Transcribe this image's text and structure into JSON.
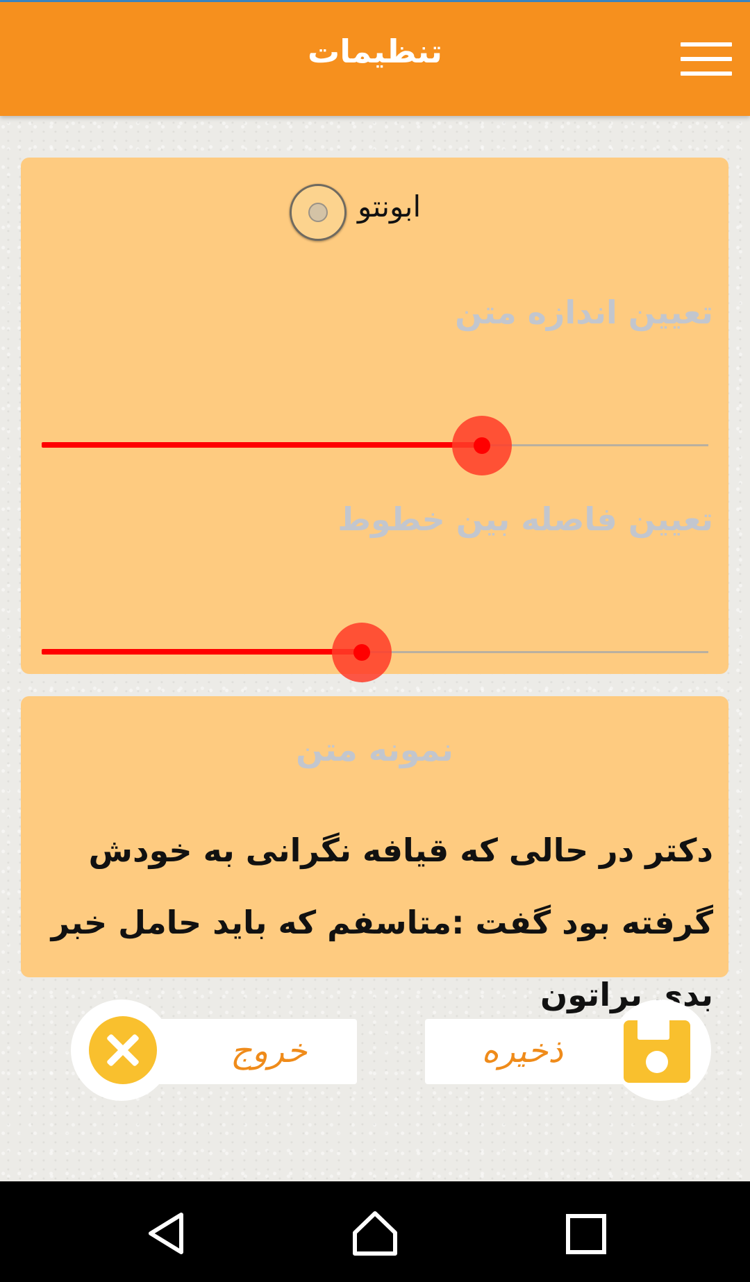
{
  "app_bar": {
    "title": "تنظیمات",
    "menu_icon": "hamburger-menu-icon",
    "background_color": "#f6901e"
  },
  "font_option": {
    "label": "ابونتو",
    "selected": false
  },
  "text_size": {
    "label": "تعیین اندازه متن",
    "value_fraction": 0.66
  },
  "line_spacing": {
    "label": "تعیین فاصله بین خطوط",
    "value_fraction": 0.48
  },
  "preview": {
    "title": "نمونه متن",
    "text": "دکتر در حالی که قیافه نگرانی به خودش گرفته بود گفت :متاسفم که باید حامل خبر بدی براتون"
  },
  "actions": {
    "exit_label": "خروج",
    "exit_icon": "close-circle-icon",
    "save_label": "ذخیره",
    "save_icon": "floppy-disk-icon"
  },
  "navigation_bar": {
    "back_icon": "back-triangle-icon",
    "home_icon": "home-icon",
    "recents_icon": "recents-square-icon"
  },
  "colors": {
    "card": "#fecb80",
    "slider_active": "#ff0000",
    "accent_button": "#f9c02e",
    "muted_label": "#c2c6ce"
  }
}
